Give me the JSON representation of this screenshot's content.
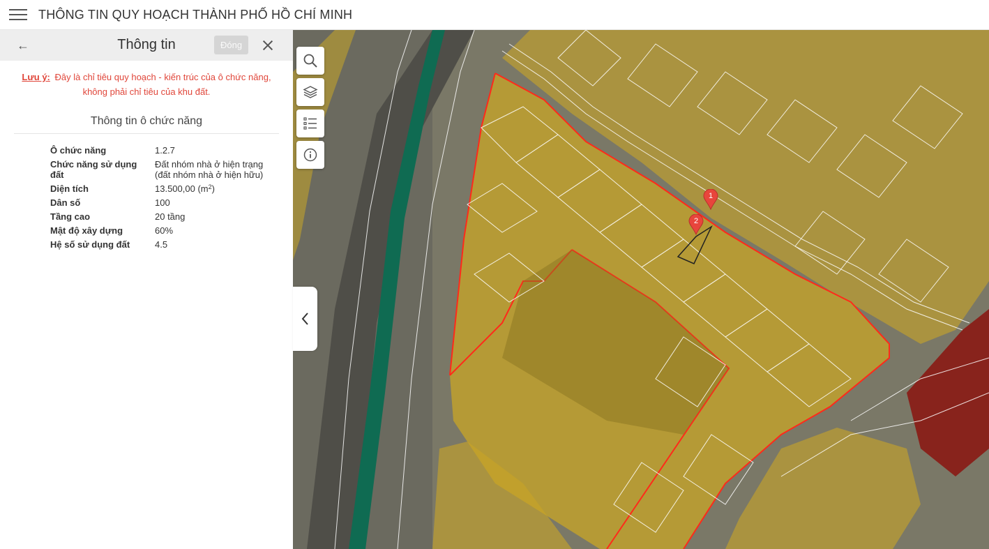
{
  "header": {
    "title": "THÔNG TIN QUY HOẠCH THÀNH PHỐ HỒ CHÍ MINH"
  },
  "panel": {
    "title": "Thông tin",
    "close_tooltip": "Đóng",
    "note_label": "Lưu ý:",
    "note_text": "Đây là chỉ tiêu quy hoạch - kiến trúc của ô chức năng, không phải chỉ tiêu của khu đất.",
    "section_title": "Thông tin ô chức năng",
    "rows": [
      {
        "label": "Ô chức năng",
        "value": "1.2.7"
      },
      {
        "label": "Chức năng sử dụng đất",
        "value": "Đất nhóm nhà ở hiện trạng (đất nhóm nhà ở hiện hữu)"
      },
      {
        "label": "Diện tích",
        "value": "13.500,00 (m",
        "value_sup": "2",
        "value_suffix": ")"
      },
      {
        "label": "Dân số",
        "value": "100"
      },
      {
        "label": "Tầng cao",
        "value": "20 tầng"
      },
      {
        "label": "Mật độ xây dựng",
        "value": "60%"
      },
      {
        "label": "Hệ số sử dụng đất",
        "value": "4.5"
      }
    ]
  },
  "map": {
    "tools": [
      "search-icon",
      "layers-icon",
      "legend-list-icon",
      "info-icon"
    ],
    "markers": [
      {
        "label": "1"
      },
      {
        "label": "2"
      }
    ],
    "colors": {
      "residential_zone": "#c9a526",
      "selected_zone_border": "#ff2a1a",
      "commercial_zone": "#8a1a14",
      "railway": "#0f6b52",
      "parcel_lines": "#ffffff",
      "marker": "#e8453c"
    }
  }
}
